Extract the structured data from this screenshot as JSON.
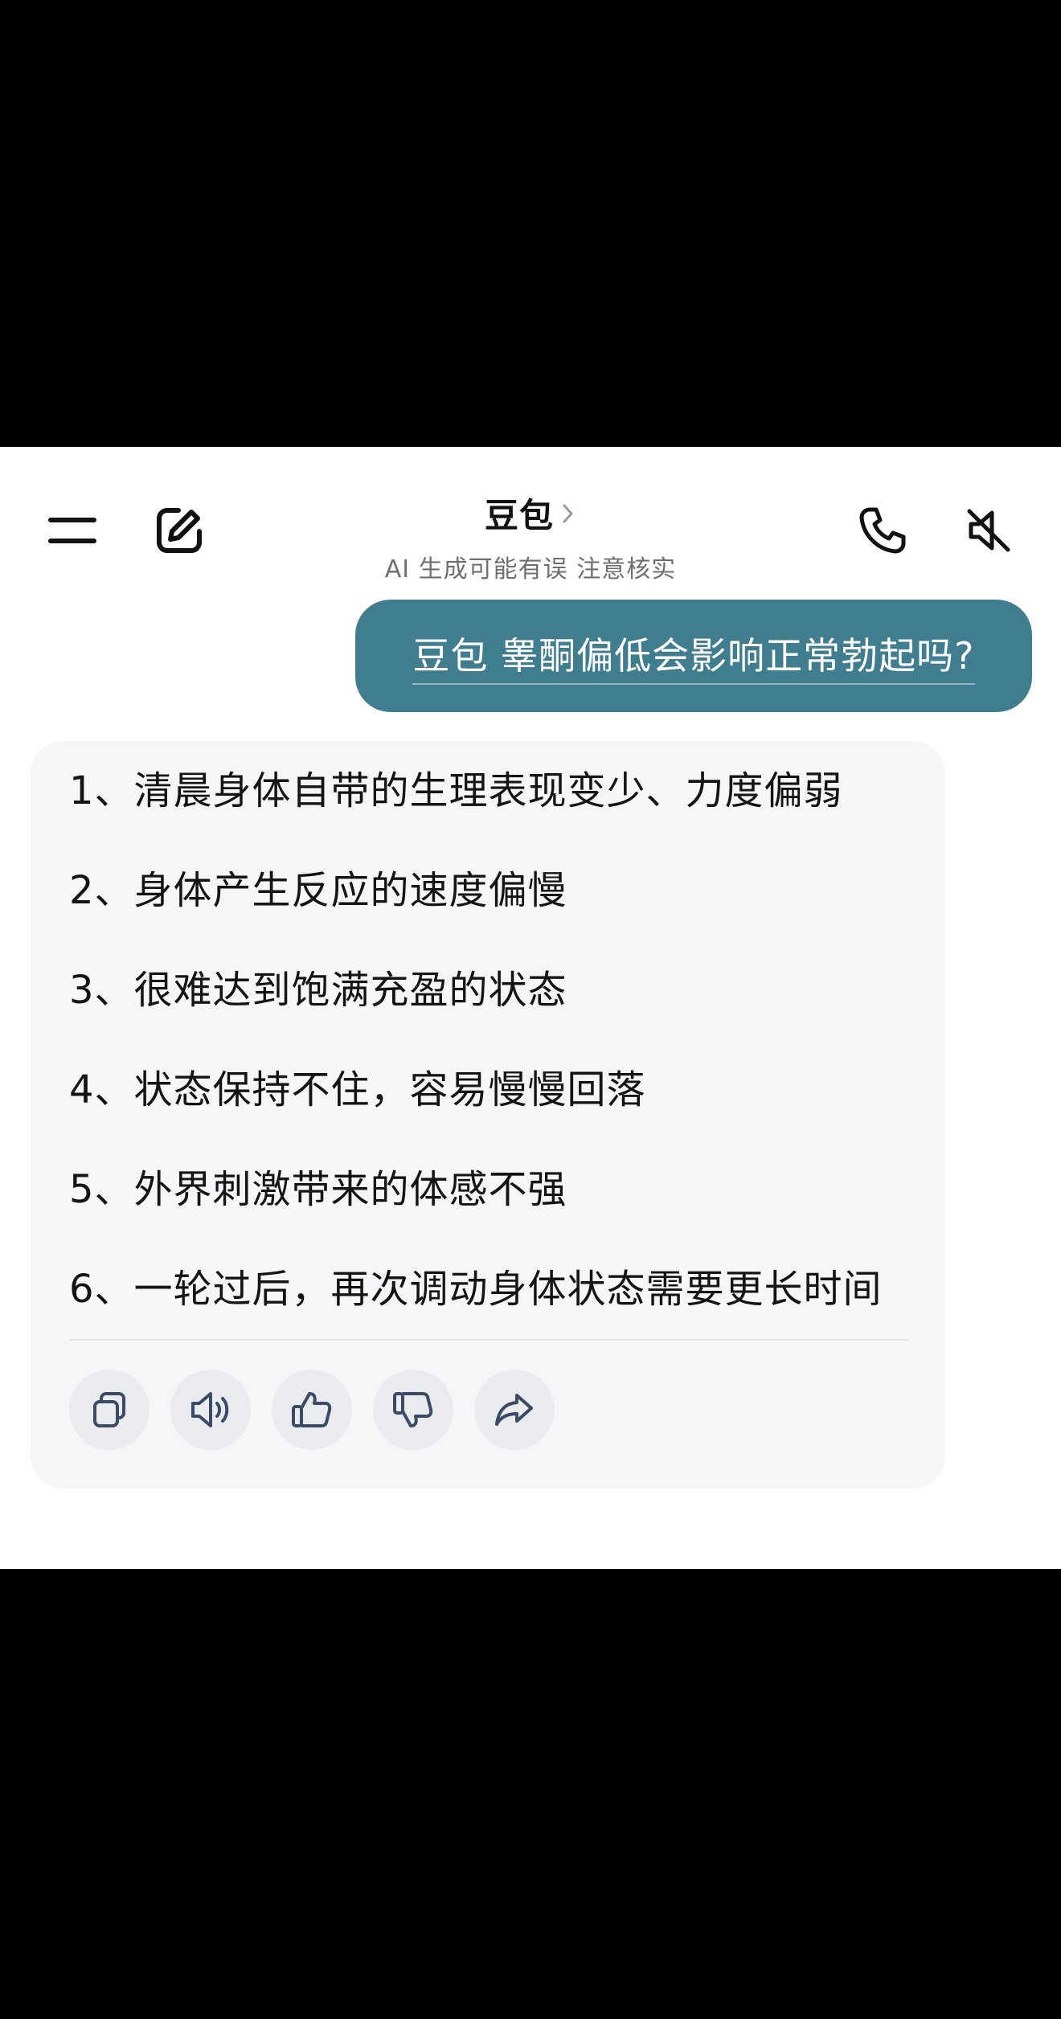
{
  "header": {
    "title": "豆包",
    "subtitle": "AI 生成可能有误 注意核实",
    "icons": {
      "menu": "menu-icon",
      "edit": "edit-icon",
      "phone": "phone-icon",
      "mute": "speaker-muted-icon",
      "chevron": "chevron-right-icon"
    }
  },
  "conversation": {
    "user_message": "豆包 睾酮偏低会影响正常勃起吗?",
    "ai_items": [
      "1、清晨身体自带的生理表现变少、力度偏弱",
      "2、身体产生反应的速度偏慢",
      "3、很难达到饱满充盈的状态",
      "4、状态保持不住，容易慢慢回落",
      "5、外界刺激带来的体感不强",
      "6、一轮过后，再次调动身体状态需要更长时间"
    ],
    "actions": [
      "copy-icon",
      "speaker-icon",
      "thumbs-up-icon",
      "thumbs-down-icon",
      "share-icon"
    ]
  },
  "colors": {
    "user_bubble": "#3f7d8f",
    "ai_card": "#f5f6f8",
    "action_button": "#e9ebef"
  }
}
